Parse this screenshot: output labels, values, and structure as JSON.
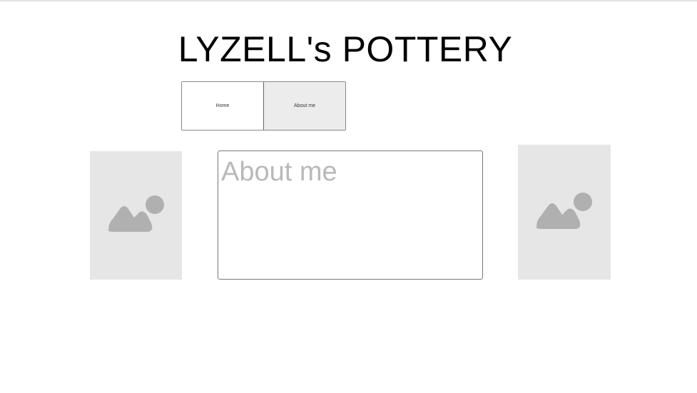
{
  "header": {
    "title": "LYZELL's POTTERY"
  },
  "nav": {
    "tabs": [
      {
        "label": "Home",
        "active": false
      },
      {
        "label": "About me",
        "active": true
      }
    ]
  },
  "main": {
    "heading": "About me"
  },
  "images": {
    "left": {
      "icon": "image-icon"
    },
    "right": {
      "icon": "image-icon"
    }
  },
  "colors": {
    "placeholder_bg": "#e6e6e6",
    "placeholder_icon": "#b0b0b0",
    "active_tab_bg": "#ececec",
    "heading_text": "#b9b9b9"
  }
}
